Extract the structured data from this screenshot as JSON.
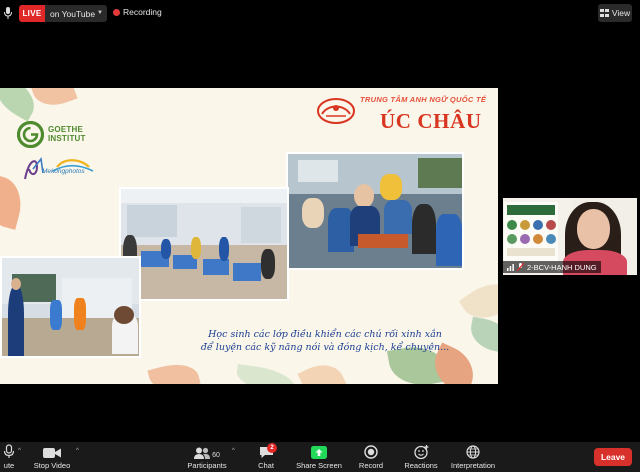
{
  "topbar": {
    "live_label": "LIVE",
    "stream_label": "on YouTube",
    "recording_label": "Recording",
    "view_label": "View"
  },
  "slide": {
    "goethe_line1": "GOETHE",
    "goethe_line2": "INSTITUT",
    "mekong_label": "Mekongphotos",
    "center_name_top": "TRUNG TÂM ANH NGỮ QUỐC TẾ",
    "center_name_main": "ÚC CHÂU",
    "caption_line1": "Học sinh các lớp điều khiển các chú rối xinh xắn",
    "caption_line2": "để luyện các kỹ năng nói và đóng kịch, kể chuyện..."
  },
  "participant": {
    "name": "2-BCV-HẠNH DUNG"
  },
  "toolbar": {
    "mute_label": "ute",
    "stop_video_label": "Stop Video",
    "participants_label": "Participants",
    "participants_count": "60",
    "chat_label": "Chat",
    "chat_badge": "2",
    "share_label": "Share Screen",
    "record_label": "Record",
    "reactions_label": "Reactions",
    "interpretation_label": "Interpretation",
    "leave_label": "Leave"
  },
  "colors": {
    "live_red": "#e02828",
    "share_green": "#23d959",
    "leave_red": "#d8302b",
    "caption_blue": "#1b3f93"
  }
}
